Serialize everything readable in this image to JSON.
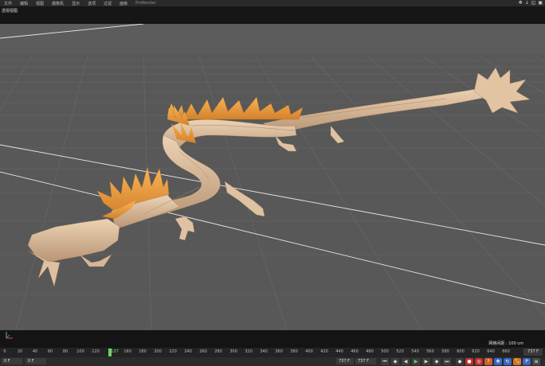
{
  "menu": [
    "文件",
    "编辑",
    "视图",
    "摄像机",
    "显示",
    "选项",
    "过滤",
    "面板",
    "ProRender"
  ],
  "viewport_label": "透视视图",
  "grid_info": "网格间距 : 100 cm",
  "timeline": {
    "ticks": [
      "0",
      "20",
      "40",
      "60",
      "80",
      "100",
      "120",
      "137",
      "160",
      "180",
      "200",
      "220",
      "240",
      "260",
      "280",
      "300",
      "320",
      "340",
      "360",
      "380",
      "400",
      "420",
      "440",
      "460",
      "480",
      "500",
      "520",
      "540",
      "560",
      "580",
      "600",
      "620",
      "640",
      "660"
    ],
    "current_index": 7,
    "end_frame": "737 F"
  },
  "transport": {
    "start_field": "0 F",
    "second_field": "0 F",
    "third_field": "737 F",
    "fourth_field": "737 F",
    "current_frame_small": "137 F"
  },
  "icons": {
    "top_right": [
      "move-icon",
      "pin-icon",
      "window-icon",
      "layout-icon"
    ],
    "transport_buttons": [
      "go-start-icon",
      "prev-key-icon",
      "prev-frame-icon",
      "play-icon",
      "next-frame-icon",
      "next-key-icon",
      "go-end-icon"
    ],
    "record_buttons": [
      "keyframe-icon",
      "record-icon",
      "autokey-icon",
      "selection-key-icon",
      "position-key-icon",
      "rotation-key-icon",
      "scale-key-icon",
      "param-key-icon",
      "pla-key-icon",
      "timeline-menu-icon"
    ]
  },
  "colors": {
    "viewport_bg": "#595959",
    "dragon_body": "#d8b898",
    "dragon_spines": "#f0a040",
    "playhead": "#6fd06f"
  }
}
